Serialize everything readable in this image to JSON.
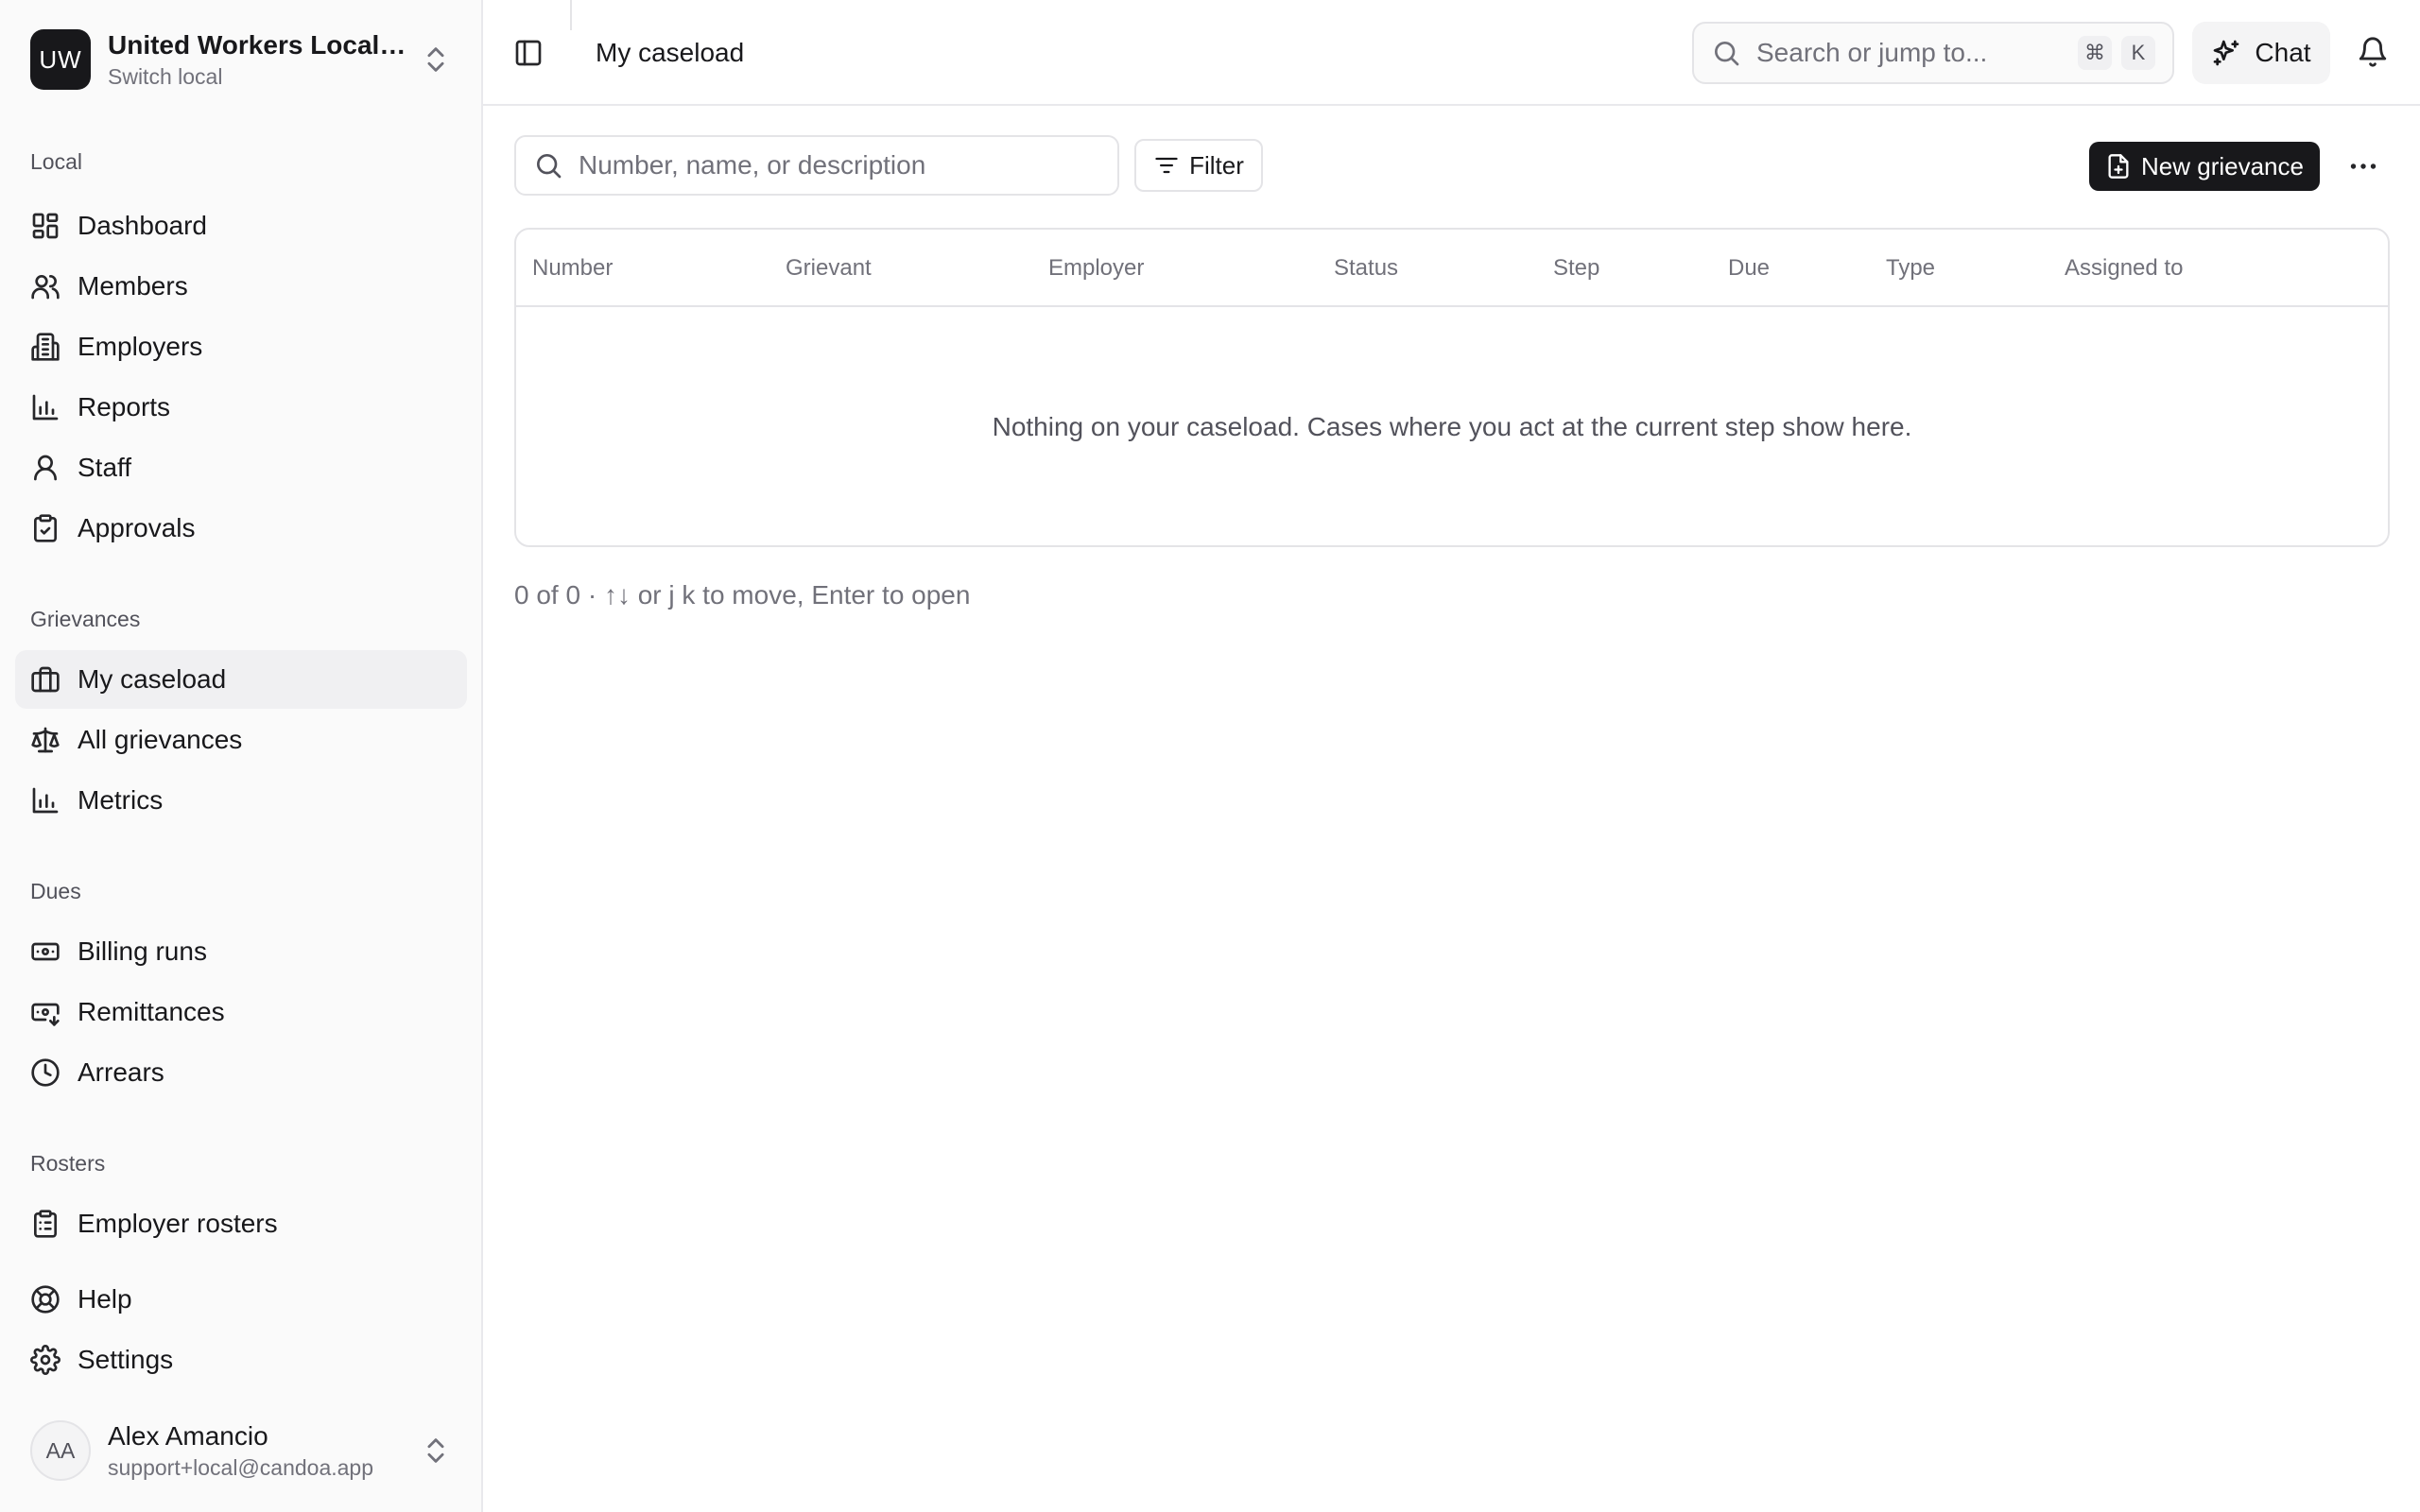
{
  "org": {
    "initials": "UW",
    "name": "United Workers Local ...",
    "switch_label": "Switch local"
  },
  "sections": {
    "local": "Local",
    "grievances": "Grievances",
    "dues": "Dues",
    "rosters": "Rosters"
  },
  "nav": {
    "dashboard": "Dashboard",
    "members": "Members",
    "employers": "Employers",
    "reports": "Reports",
    "staff": "Staff",
    "approvals": "Approvals",
    "my_caseload": "My caseload",
    "all_grievances": "All grievances",
    "metrics": "Metrics",
    "billing_runs": "Billing runs",
    "remittances": "Remittances",
    "arrears": "Arrears",
    "employer_rosters": "Employer rosters",
    "help": "Help",
    "settings": "Settings"
  },
  "user": {
    "initials": "AA",
    "name": "Alex Amancio",
    "email": "support+local@candoa.app"
  },
  "header": {
    "title": "My caseload",
    "search_placeholder": "Search or jump to...",
    "kbd_cmd": "⌘",
    "kbd_k": "K",
    "chat_label": "Chat"
  },
  "toolbar": {
    "filter_placeholder": "Number, name, or description",
    "filter_label": "Filter",
    "new_grievance_label": "New grievance"
  },
  "table": {
    "columns": [
      "Number",
      "Grievant",
      "Employer",
      "Status",
      "Step",
      "Due",
      "Type",
      "Assigned to"
    ],
    "empty_message": "Nothing on your caseload. Cases where you act at the current step show here."
  },
  "footer_hint": "0 of 0 · ↑↓ or j k to move, Enter to open"
}
